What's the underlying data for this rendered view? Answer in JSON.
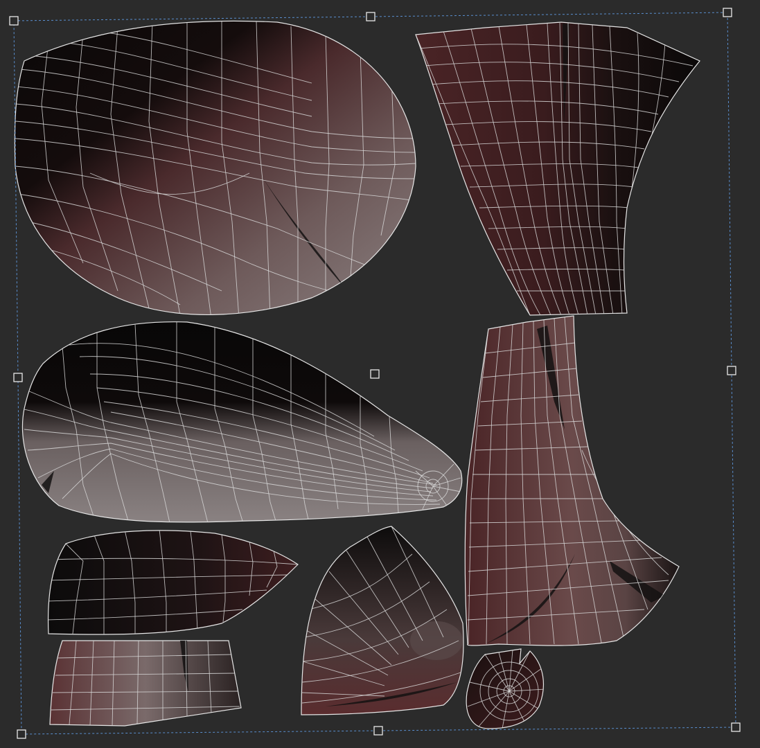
{
  "viewport": {
    "background_color": "#2b2b2b",
    "wireframe_color": "#e6e6e6",
    "selection_color": "#5a8fd0",
    "skin_colors": [
      "#0a0808",
      "#3a1c1e",
      "#5a3133",
      "#7a6868",
      "#9a9090"
    ]
  },
  "icons": {
    "transform_handle": "square-handle",
    "pivot": "pivot-square"
  }
}
